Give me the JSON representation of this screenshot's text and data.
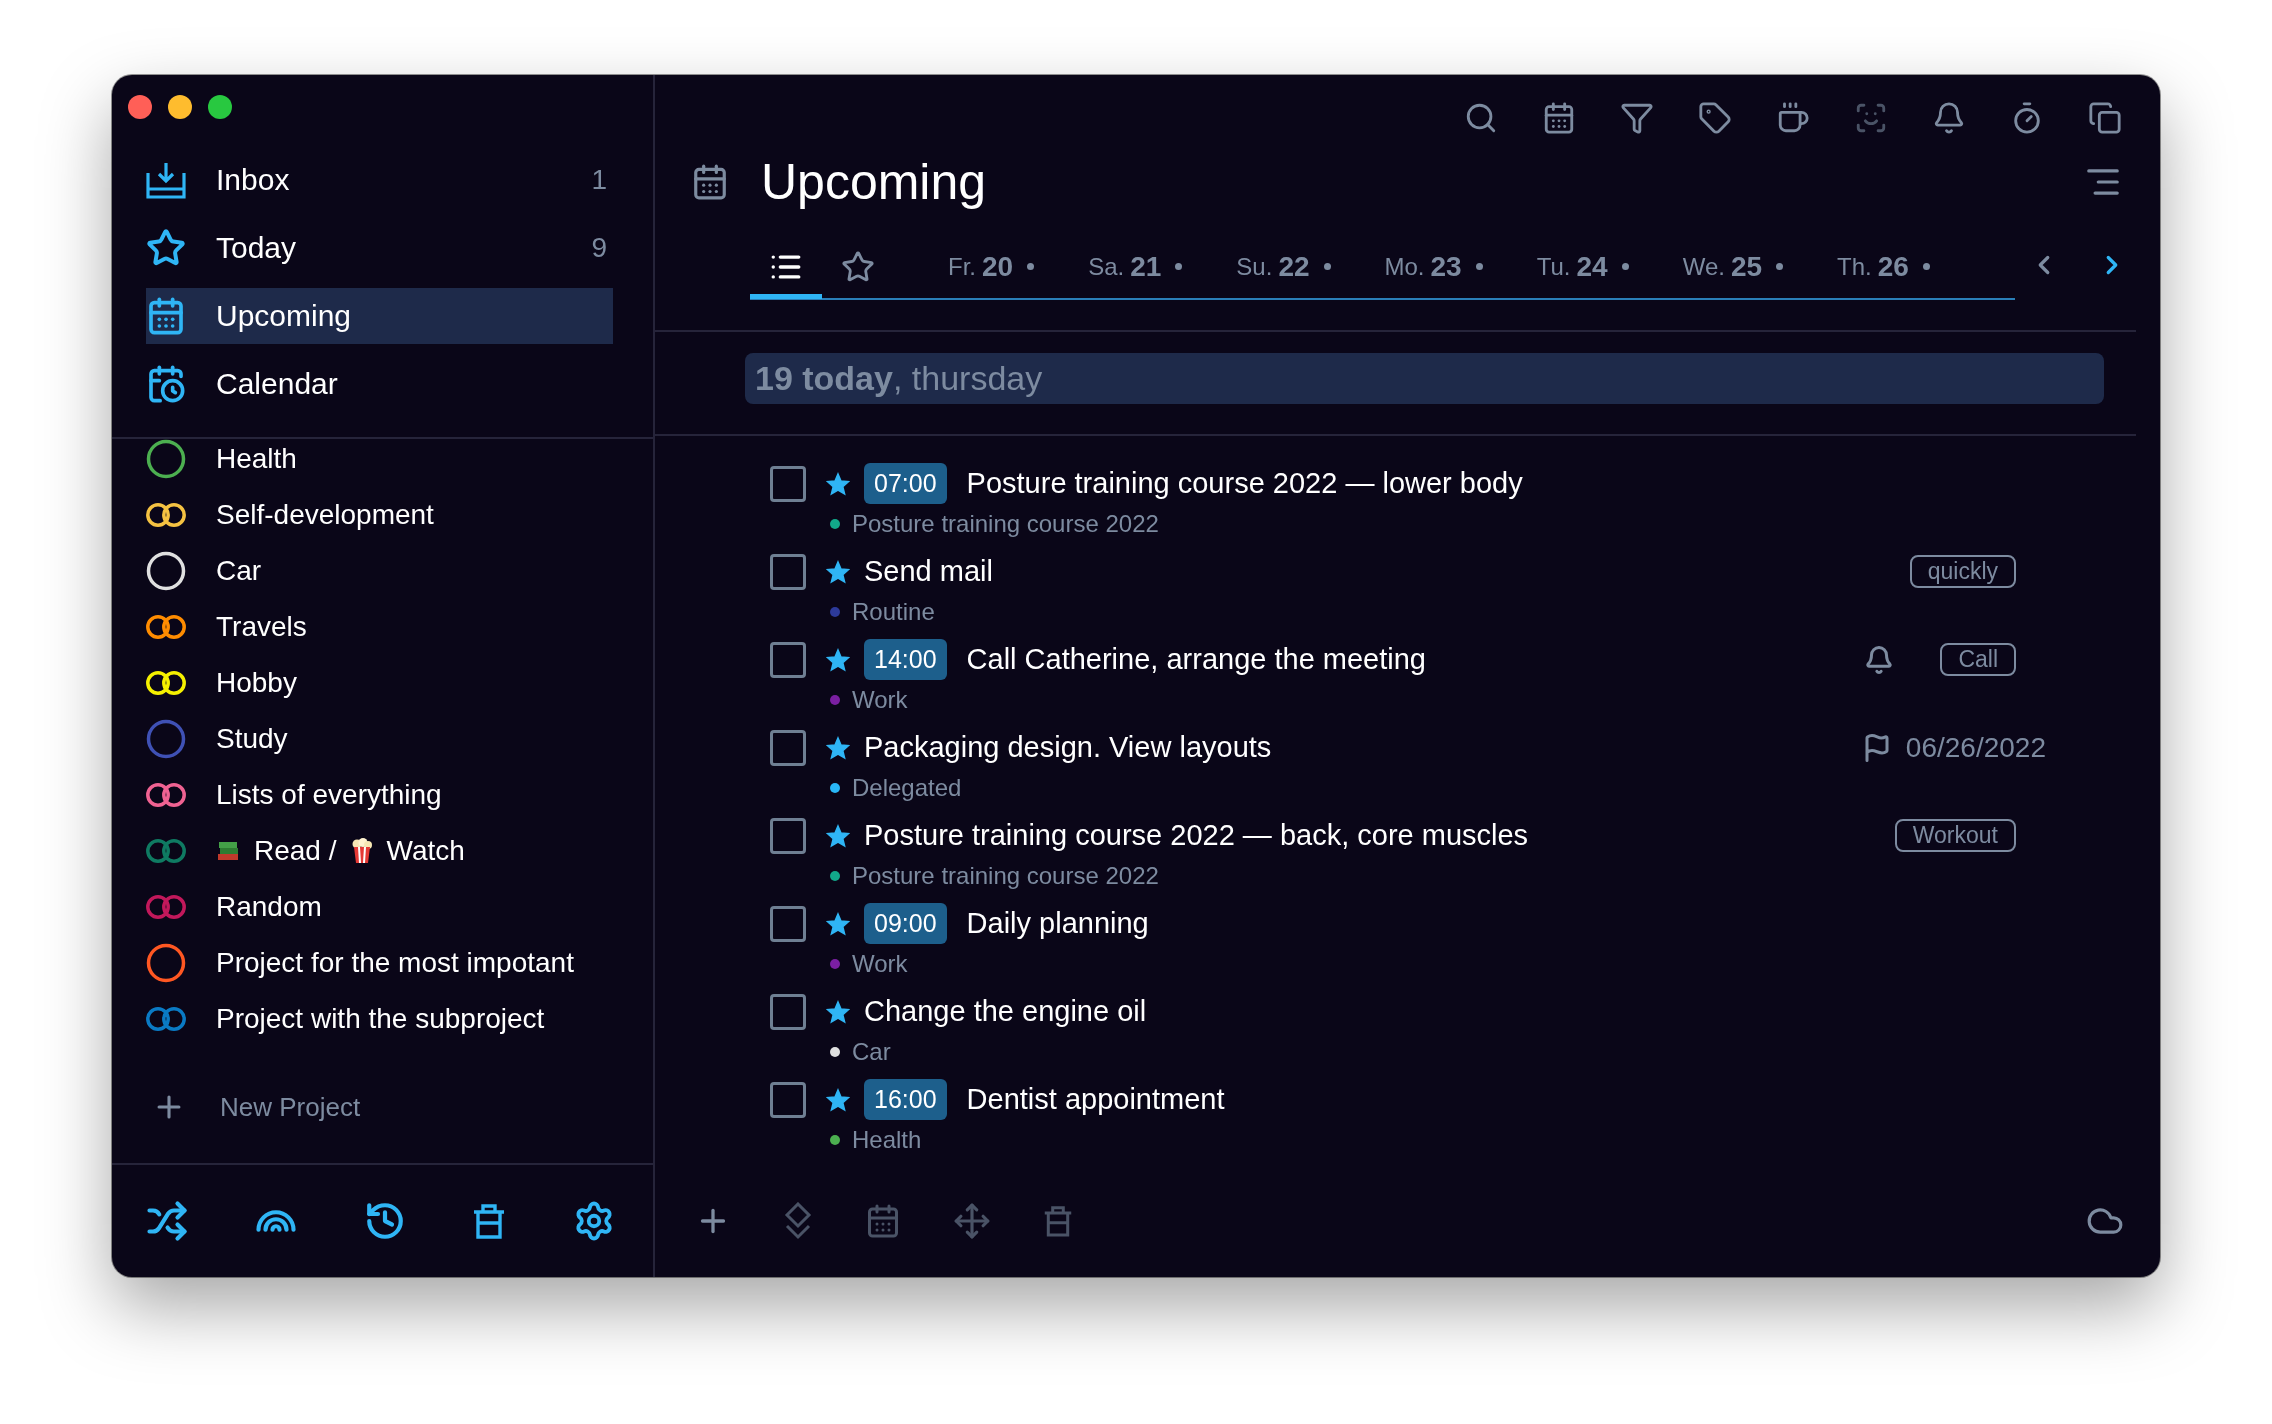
{
  "sidebar": {
    "nav": [
      {
        "kind": "inbox",
        "label": "Inbox",
        "count": "1",
        "selected": false
      },
      {
        "kind": "today",
        "label": "Today",
        "count": "9",
        "selected": false
      },
      {
        "kind": "upcoming",
        "label": "Upcoming",
        "selected": true
      },
      {
        "kind": "calendar",
        "label": "Calendar",
        "selected": false
      }
    ],
    "projects": [
      {
        "kind": "single",
        "color": "#4caf50",
        "label": "Health"
      },
      {
        "kind": "double",
        "color": "#f5c242",
        "label": "Self-development"
      },
      {
        "kind": "single",
        "color": "#e0e0e0",
        "label": "Car"
      },
      {
        "kind": "double",
        "color": "#ff8c00",
        "label": "Travels"
      },
      {
        "kind": "double",
        "color": "#f5f000",
        "label": "Hobby"
      },
      {
        "kind": "single",
        "color": "#3f51b5",
        "label": "Study"
      },
      {
        "kind": "double",
        "color": "#f06292",
        "label": "Lists of everything"
      },
      {
        "kind": "double",
        "color": "#0f7a62",
        "segments": [
          "Read /",
          "Watch"
        ]
      },
      {
        "kind": "double",
        "color": "#c2185b",
        "label": "Random"
      },
      {
        "kind": "single",
        "color": "#ff5722",
        "label": "Project for the most impotant"
      },
      {
        "kind": "double",
        "color": "#0a7ac4",
        "label": "Project with the subproject"
      }
    ],
    "new_project": "New Project"
  },
  "main": {
    "title": "Upcoming",
    "view_tabs": [
      {
        "kind": "list",
        "selected": true
      },
      {
        "kind": "starred",
        "selected": false
      }
    ],
    "days": [
      {
        "weekday": "Fr.",
        "date": "20",
        "dot": true,
        "selected": false
      },
      {
        "weekday": "Sa.",
        "date": "21",
        "dot": true,
        "selected": false
      },
      {
        "weekday": "Su.",
        "date": "22",
        "dot": true,
        "selected": false
      },
      {
        "weekday": "Mo.",
        "date": "23",
        "dot": true,
        "selected": false
      },
      {
        "weekday": "Tu.",
        "date": "24",
        "dot": true,
        "selected": false
      },
      {
        "weekday": "We.",
        "date": "25",
        "dot": true,
        "selected": false
      },
      {
        "weekday": "Th.",
        "date": "26",
        "dot": true,
        "selected": false
      }
    ],
    "banner": "**19 today**, thursday",
    "tasks": [
      {
        "checked": false,
        "starred": true,
        "time": "07:00",
        "title": "Posture training course 2022 — lower body",
        "project": "Posture training course 2022",
        "color": "#12a88a"
      },
      {
        "checked": false,
        "starred": true,
        "title": "Send mail",
        "project": "Routine",
        "color": "#2d3a9a",
        "tag": "quickly"
      },
      {
        "checked": false,
        "starred": true,
        "time": "14:00",
        "title": "Call Catherine, arrange the meeting",
        "project": "Work",
        "color": "#7b1fa2",
        "reminder": true,
        "tag": "Call"
      },
      {
        "checked": false,
        "starred": true,
        "title": "Packaging design. View layouts",
        "project": "Delegated",
        "color": "#29b6f6",
        "due": "06/26/2022"
      },
      {
        "checked": false,
        "starred": true,
        "title": "Posture training course 2022 — back, core muscles",
        "project": "Posture training course 2022",
        "color": "#12a88a",
        "tag": "Workout"
      },
      {
        "checked": false,
        "starred": true,
        "time": "09:00",
        "title": "Daily planning",
        "project": "Work",
        "color": "#7b1fa2"
      },
      {
        "checked": false,
        "starred": true,
        "title": "Change the engine oil",
        "project": "Car",
        "color": "#e0e0e0"
      },
      {
        "checked": false,
        "starred": true,
        "time": "16:00",
        "title": "Dentist appointment",
        "project": "Health",
        "color": "#4caf50"
      }
    ]
  }
}
